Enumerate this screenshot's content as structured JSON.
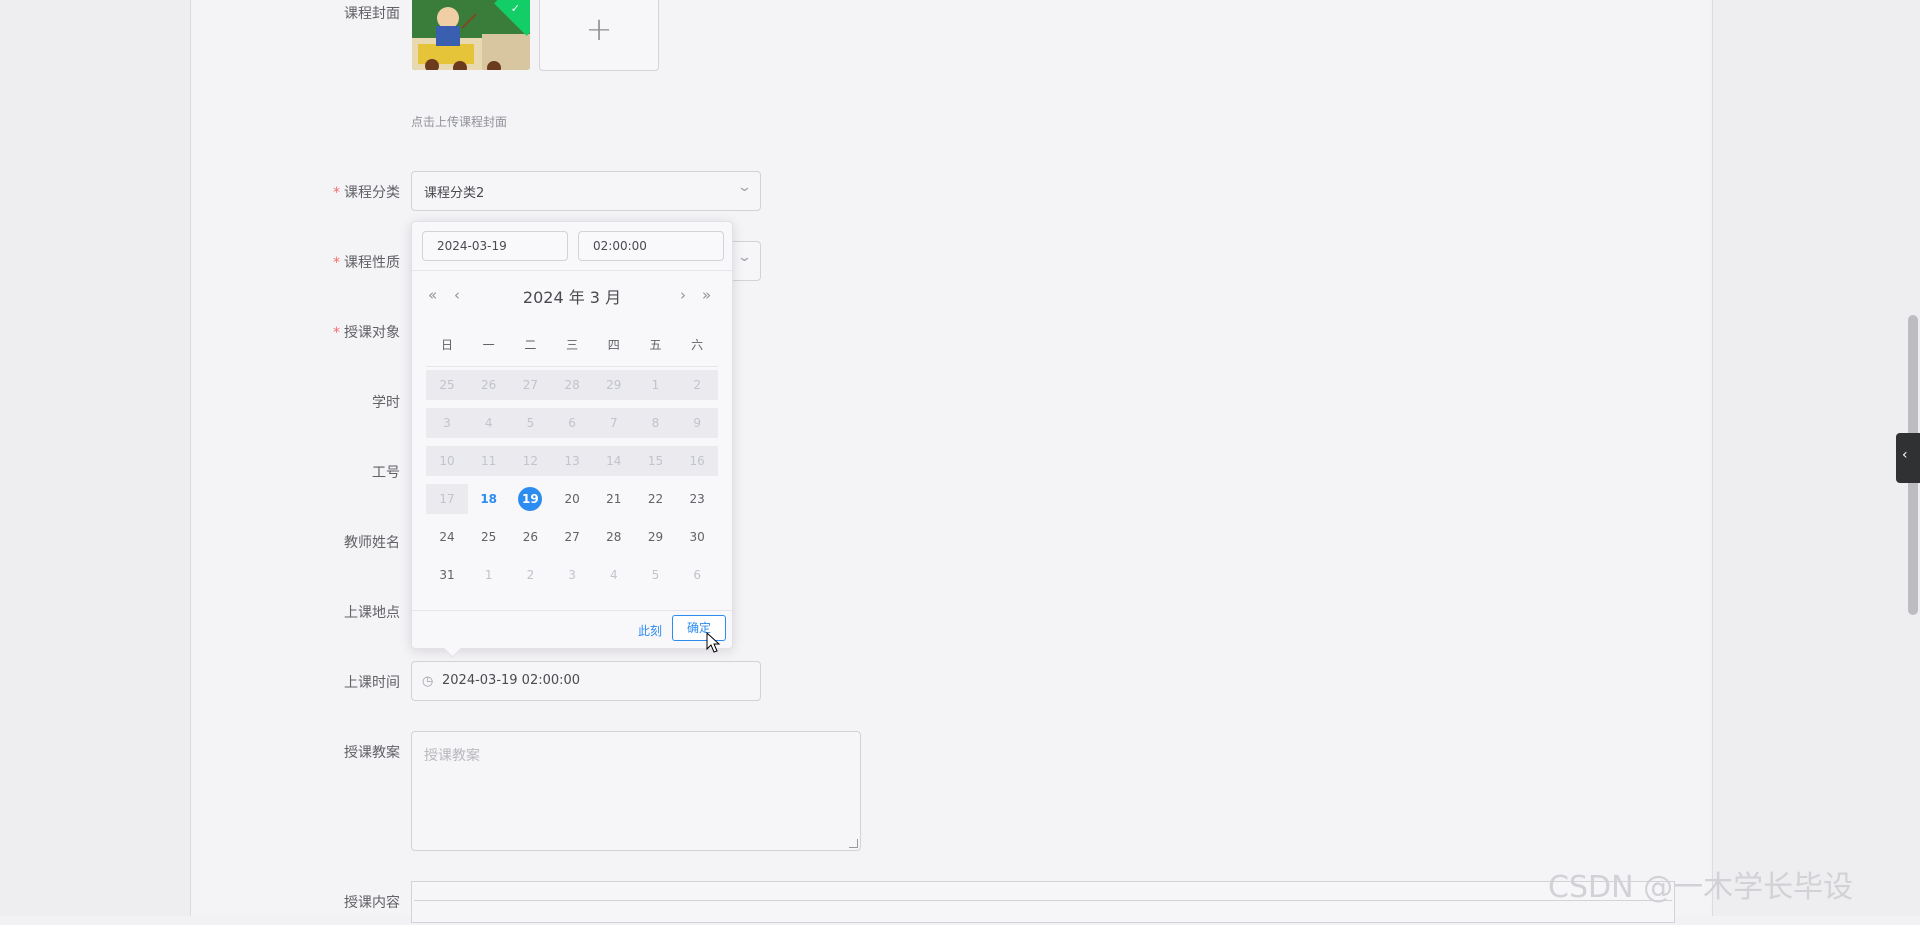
{
  "form": {
    "cover": {
      "label": "课程封面",
      "hint": "点击上传课程封面",
      "upload_symbol": "+"
    },
    "category": {
      "label": "课程分类",
      "value": "课程分类2"
    },
    "nature": {
      "label": "课程性质"
    },
    "audience": {
      "label": "授课对象"
    },
    "hours": {
      "label": "学时"
    },
    "staff_id": {
      "label": "工号"
    },
    "teacher_name": {
      "label": "教师姓名"
    },
    "location": {
      "label": "上课地点"
    },
    "class_time": {
      "label": "上课时间",
      "value": "2024-03-19 02:00:00"
    },
    "lesson_plan": {
      "label": "授课教案",
      "placeholder": "授课教案"
    },
    "content": {
      "label": "授课内容"
    },
    "required_mark": "*"
  },
  "picker": {
    "date_input": "2024-03-19",
    "time_input": "02:00:00",
    "title": "2024 年  3 月",
    "prev_year": "«",
    "prev_month": "‹",
    "next_month": "›",
    "next_year": "»",
    "weekdays": [
      "日",
      "一",
      "二",
      "三",
      "四",
      "五",
      "六"
    ],
    "weeks": [
      [
        {
          "d": "25",
          "s": "dis"
        },
        {
          "d": "26",
          "s": "dis"
        },
        {
          "d": "27",
          "s": "dis"
        },
        {
          "d": "28",
          "s": "dis"
        },
        {
          "d": "29",
          "s": "dis"
        },
        {
          "d": "1",
          "s": "dis"
        },
        {
          "d": "2",
          "s": "dis"
        }
      ],
      [
        {
          "d": "3",
          "s": "dis"
        },
        {
          "d": "4",
          "s": "dis"
        },
        {
          "d": "5",
          "s": "dis"
        },
        {
          "d": "6",
          "s": "dis"
        },
        {
          "d": "7",
          "s": "dis"
        },
        {
          "d": "8",
          "s": "dis"
        },
        {
          "d": "9",
          "s": "dis"
        }
      ],
      [
        {
          "d": "10",
          "s": "dis"
        },
        {
          "d": "11",
          "s": "dis"
        },
        {
          "d": "12",
          "s": "dis"
        },
        {
          "d": "13",
          "s": "dis"
        },
        {
          "d": "14",
          "s": "dis"
        },
        {
          "d": "15",
          "s": "dis"
        },
        {
          "d": "16",
          "s": "dis"
        }
      ],
      [
        {
          "d": "17",
          "s": "dis"
        },
        {
          "d": "18",
          "s": "today"
        },
        {
          "d": "19",
          "s": "sel"
        },
        {
          "d": "20",
          "s": "norm"
        },
        {
          "d": "21",
          "s": "norm"
        },
        {
          "d": "22",
          "s": "norm"
        },
        {
          "d": "23",
          "s": "norm"
        }
      ],
      [
        {
          "d": "24",
          "s": "norm"
        },
        {
          "d": "25",
          "s": "norm"
        },
        {
          "d": "26",
          "s": "norm"
        },
        {
          "d": "27",
          "s": "norm"
        },
        {
          "d": "28",
          "s": "norm"
        },
        {
          "d": "29",
          "s": "norm"
        },
        {
          "d": "30",
          "s": "norm"
        }
      ],
      [
        {
          "d": "31",
          "s": "norm"
        },
        {
          "d": "1",
          "s": "oth"
        },
        {
          "d": "2",
          "s": "oth"
        },
        {
          "d": "3",
          "s": "oth"
        },
        {
          "d": "4",
          "s": "oth"
        },
        {
          "d": "5",
          "s": "oth"
        },
        {
          "d": "6",
          "s": "oth"
        }
      ]
    ],
    "now_label": "此刻",
    "ok_label": "确定"
  },
  "icons": {
    "clock": "clock-icon",
    "chevron": "chevron-down-icon",
    "side_toggle": "chevron-left-icon"
  },
  "side_tab_symbol": "‹",
  "watermark": "CSDN @一木学长毕设",
  "colors": {
    "accent": "#2d8cf0",
    "required": "#f56c6c",
    "upload_success": "#13ce66"
  }
}
